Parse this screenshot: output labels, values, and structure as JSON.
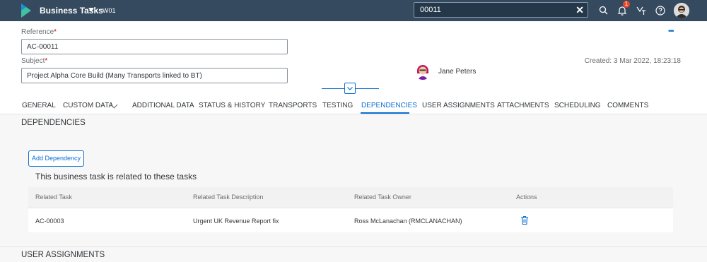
{
  "shell": {
    "app_title": "Business Tasks",
    "app_subtitle": "W01",
    "search_value": "00011",
    "notification_count": "1"
  },
  "header": {
    "reference_label": "Reference",
    "reference_value": "AC-00011",
    "subject_label": "Subject",
    "subject_value": "Project Alpha Core Build (Many Transports linked to BT)",
    "owner_name": "Jane Peters",
    "created_text": "Created: 3 Mar 2022, 18:23:18",
    "required_marker": "*"
  },
  "tabs": [
    {
      "label": "GENERAL"
    },
    {
      "label": "CUSTOM DATA"
    },
    {
      "label": "ADDITIONAL DATA"
    },
    {
      "label": "STATUS & HISTORY"
    },
    {
      "label": "TRANSPORTS"
    },
    {
      "label": "TESTING"
    },
    {
      "label": "DEPENDENCIES"
    },
    {
      "label": "USER ASSIGNMENTS"
    },
    {
      "label": "ATTACHMENTS"
    },
    {
      "label": "SCHEDULING"
    },
    {
      "label": "COMMENTS"
    }
  ],
  "dependencies": {
    "section_title": "DEPENDENCIES",
    "add_button": "Add Dependency",
    "table_title": "This business task is related to these tasks",
    "columns": [
      "Related Task",
      "Related Task Description",
      "Related Task Owner",
      "Actions"
    ],
    "rows": [
      {
        "task": "AC-00003",
        "description": "Urgent UK Revenue Report fix",
        "owner": "Ross McLanachan (RMCLANACHAN)"
      }
    ]
  },
  "next_section_title": "USER ASSIGNMENTS",
  "colors": {
    "shell_bg": "#354a5f",
    "accent": "#0a6ed1",
    "badge": "#e9472a",
    "required": "#bb0000"
  },
  "icons": [
    "sap-logo-icon",
    "caret-down-icon",
    "clear-icon",
    "search-icon",
    "bell-icon",
    "copilot-icon",
    "help-icon",
    "user-avatar",
    "more-icon",
    "chevron-down-icon",
    "trash-icon"
  ]
}
